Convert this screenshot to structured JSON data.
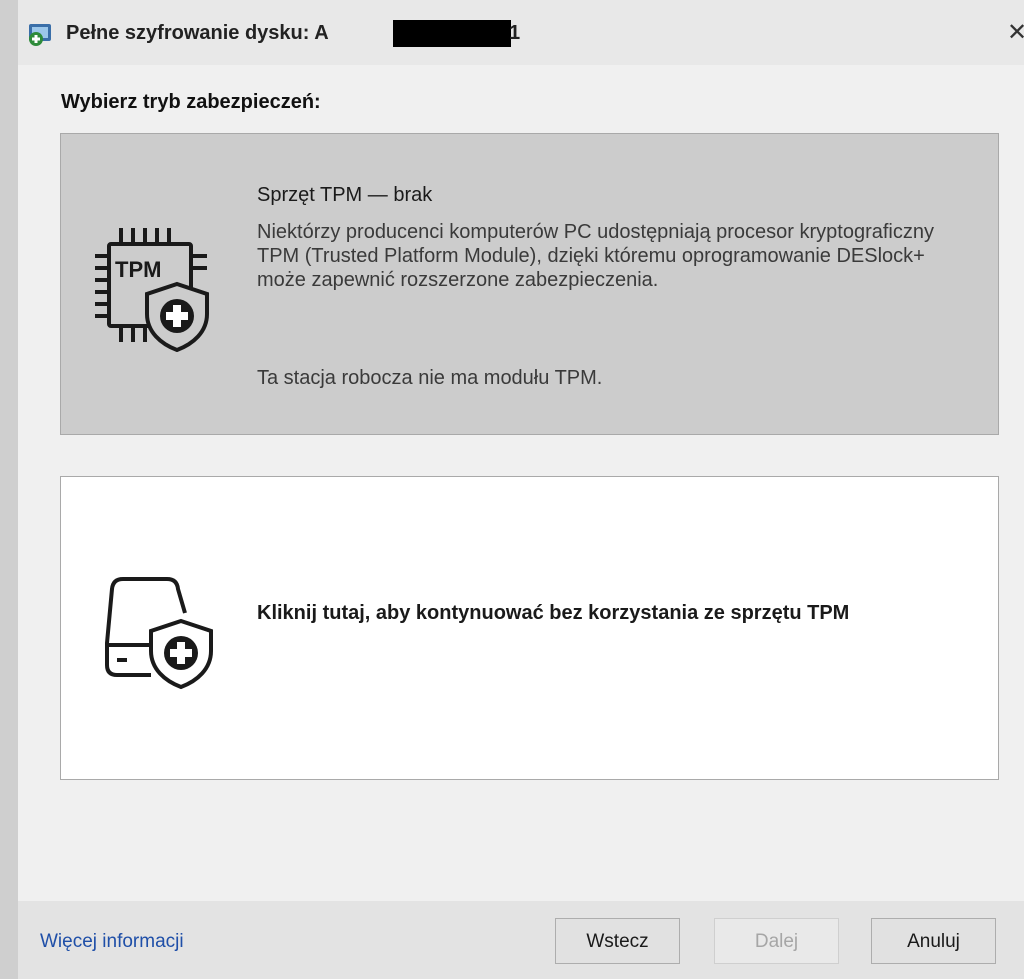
{
  "window": {
    "title": "Pełne szyfrowanie dysku: A",
    "title_suffix": "1",
    "close_glyph": "✕"
  },
  "prompt": "Wybierz tryb zabezpieczeń:",
  "option_tpm": {
    "icon": "tpm-chip-shield-icon",
    "icon_text": "TPM",
    "heading": "Sprzęt TPM — brak",
    "description": "Niektórzy producenci komputerów PC udostępniają procesor kryptograficzny TPM (Trusted Platform Module), dzięki któremu oprogramowanie DESlock+ może zapewnić rozszerzone zabezpieczenia.",
    "note": "Ta stacja robocza nie ma modułu TPM."
  },
  "option_no_tpm": {
    "icon": "drive-shield-icon",
    "label": "Kliknij tutaj, aby kontynuować bez korzystania ze sprzętu TPM"
  },
  "footer": {
    "more_info": "Więcej informacji",
    "back": "Wstecz",
    "next": "Dalej",
    "cancel": "Anuluj"
  },
  "colors": {
    "link": "#1f4fa8",
    "selected_option_bg": "#cccccc",
    "disabled_text": "#a6a6a6"
  }
}
